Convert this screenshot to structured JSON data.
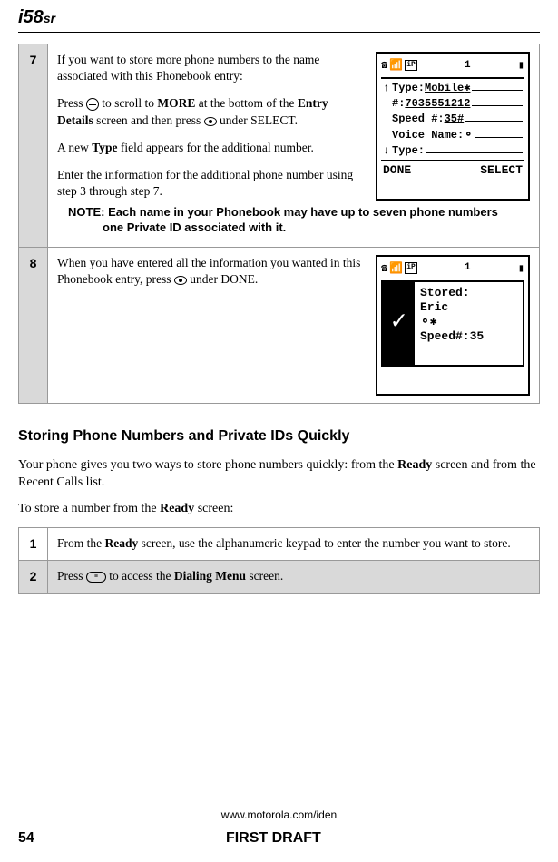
{
  "header": {
    "logo_main": "i58",
    "logo_suffix": "sr"
  },
  "step7": {
    "number": "7",
    "para1_pre": "If you want to store more phone numbers to the name associated with this Phonebook entry:",
    "para2_pre": "Press ",
    "para2_mid1": " to scroll to ",
    "para2_bold1": "MORE",
    "para2_mid2": " at the bottom of the ",
    "para2_bold2": "Entry Details",
    "para2_mid3": " screen and then press ",
    "para2_end": " under SELECT.",
    "para3_pre": "A new ",
    "para3_bold": "Type",
    "para3_end": " field appears for the additional number.",
    "para4": "Enter the information for the additional phone number using step 3 through step 7.",
    "screen": {
      "type_label": "Type:",
      "type_value": "Mobile",
      "num_label": "#:",
      "num_value": "7035551212",
      "speed_label": "Speed #:",
      "speed_value": "35#",
      "voice_label": "Voice Name:",
      "type2_label": "Type:",
      "left_btn": "DONE",
      "right_btn": "SELECT",
      "status_num": "1"
    },
    "note_label": "NOTE:",
    "note_text": " Each name in your Phonebook may have up to seven phone numbers one Private ID associated with it."
  },
  "step8": {
    "number": "8",
    "text_pre": "When you have entered all the information you wanted in this Phonebook entry, press ",
    "text_end": " under DONE.",
    "screen": {
      "status_num": "1",
      "stored_label": "Stored:",
      "name": "Eric",
      "speed_line": "Speed#:35"
    }
  },
  "section": {
    "heading": "Storing Phone Numbers and Private IDs Quickly",
    "para1_pre": "Your phone gives you two ways to store phone numbers quickly: from the ",
    "para1_bold": "Ready",
    "para1_end": " screen and from the Recent Calls list.",
    "para2_pre": "To store a number from the ",
    "para2_bold": "Ready",
    "para2_end": " screen:"
  },
  "step1": {
    "number": "1",
    "text_pre": "From the ",
    "text_bold": "Ready",
    "text_end": " screen, use the alphanumeric keypad to enter the number you want to store."
  },
  "step2": {
    "number": "2",
    "text_pre": "Press ",
    "text_mid": " to access the ",
    "text_bold": "Dialing Menu",
    "text_end": " screen."
  },
  "footer": {
    "url": "www.motorola.com/iden",
    "page": "54",
    "draft": "FIRST DRAFT"
  }
}
